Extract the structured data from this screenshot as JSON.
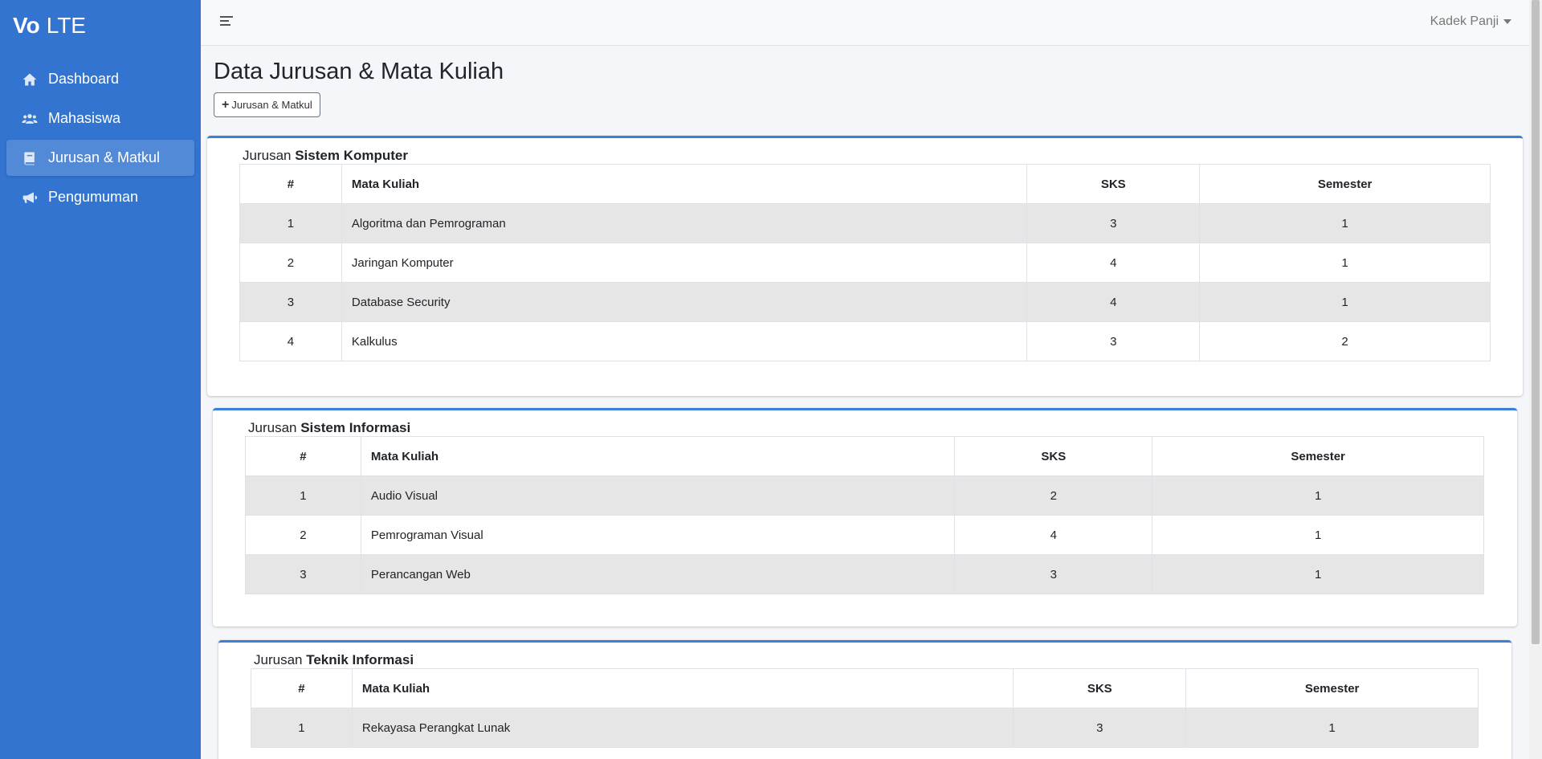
{
  "brand": {
    "bold": "Vo",
    "rest": "LTE"
  },
  "sidebar": {
    "items": [
      {
        "label": "Dashboard",
        "icon": "home-icon"
      },
      {
        "label": "Mahasiswa",
        "icon": "users-icon"
      },
      {
        "label": "Jurusan & Matkul",
        "icon": "book-icon",
        "active": true
      },
      {
        "label": "Pengumuman",
        "icon": "megaphone-icon"
      }
    ]
  },
  "navbar": {
    "user": "Kadek Panji"
  },
  "page": {
    "title": "Data Jurusan & Mata Kuliah",
    "add_button": "Jurusan & Matkul"
  },
  "table_headers": {
    "no": "#",
    "mata_kuliah": "Mata Kuliah",
    "sks": "SKS",
    "semester": "Semester"
  },
  "jurusan": [
    {
      "prefix": "Jurusan",
      "name": "Sistem Komputer",
      "rows": [
        {
          "no": "1",
          "mata_kuliah": "Algoritma dan Pemrograman",
          "sks": "3",
          "semester": "1"
        },
        {
          "no": "2",
          "mata_kuliah": "Jaringan Komputer",
          "sks": "4",
          "semester": "1"
        },
        {
          "no": "3",
          "mata_kuliah": "Database Security",
          "sks": "4",
          "semester": "1"
        },
        {
          "no": "4",
          "mata_kuliah": "Kalkulus",
          "sks": "3",
          "semester": "2"
        }
      ]
    },
    {
      "prefix": "Jurusan",
      "name": "Sistem Informasi",
      "rows": [
        {
          "no": "1",
          "mata_kuliah": "Audio Visual",
          "sks": "2",
          "semester": "1"
        },
        {
          "no": "2",
          "mata_kuliah": "Pemrograman Visual",
          "sks": "4",
          "semester": "1"
        },
        {
          "no": "3",
          "mata_kuliah": "Perancangan Web",
          "sks": "3",
          "semester": "1"
        }
      ]
    },
    {
      "prefix": "Jurusan",
      "name": "Teknik Informasi",
      "rows": [
        {
          "no": "1",
          "mata_kuliah": "Rekayasa Perangkat Lunak",
          "sks": "3",
          "semester": "1"
        }
      ]
    }
  ]
}
